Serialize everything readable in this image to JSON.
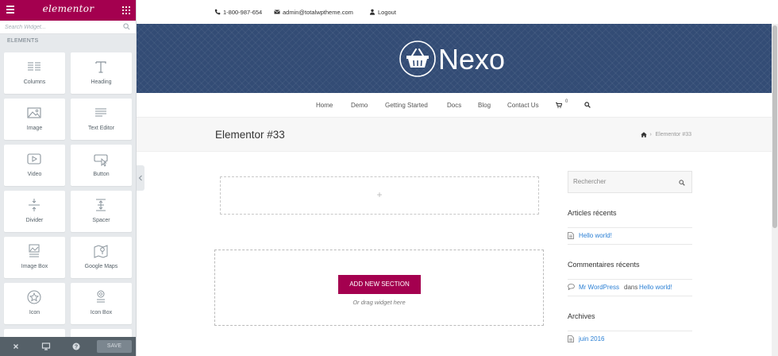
{
  "panel": {
    "logo": "elementor",
    "search_placeholder": "Search Widget...",
    "section_title": "ELEMENTS",
    "widgets": [
      {
        "label": "Columns",
        "icon": "columns-icon"
      },
      {
        "label": "Heading",
        "icon": "heading-icon"
      },
      {
        "label": "Image",
        "icon": "image-icon"
      },
      {
        "label": "Text Editor",
        "icon": "text-editor-icon"
      },
      {
        "label": "Video",
        "icon": "video-icon"
      },
      {
        "label": "Button",
        "icon": "button-icon"
      },
      {
        "label": "Divider",
        "icon": "divider-icon"
      },
      {
        "label": "Spacer",
        "icon": "spacer-icon"
      },
      {
        "label": "Image Box",
        "icon": "image-box-icon"
      },
      {
        "label": "Google Maps",
        "icon": "google-maps-icon"
      },
      {
        "label": "Icon",
        "icon": "star-icon"
      },
      {
        "label": "Icon Box",
        "icon": "icon-box-icon"
      }
    ],
    "footer": {
      "save_label": "SAVE"
    },
    "accent_color": "#a4004f"
  },
  "site": {
    "topbar": {
      "phone": "1-800-987-654",
      "email": "admin@totalwptheme.com",
      "logout": "Logout"
    },
    "brand": "Nexo",
    "nav": [
      "Home",
      "Demo",
      "Getting Started",
      "Docs",
      "Blog",
      "Contact Us"
    ],
    "cart_count": "0",
    "page_title": "Elementor #33",
    "breadcrumb_current": "Elementor #33",
    "editor": {
      "add_section_label": "ADD NEW SECTION",
      "drag_hint": "Or drag widget here",
      "plus": "+"
    },
    "sidebar": {
      "search_placeholder": "Rechercher",
      "recent_posts_title": "Articles récents",
      "recent_posts": [
        "Hello world!"
      ],
      "recent_comments_title": "Commentaires récents",
      "comment_author": "Mr WordPress",
      "comment_joiner": "dans",
      "comment_post": "Hello world!",
      "archives_title": "Archives",
      "archives": [
        "juin 2016"
      ]
    }
  }
}
